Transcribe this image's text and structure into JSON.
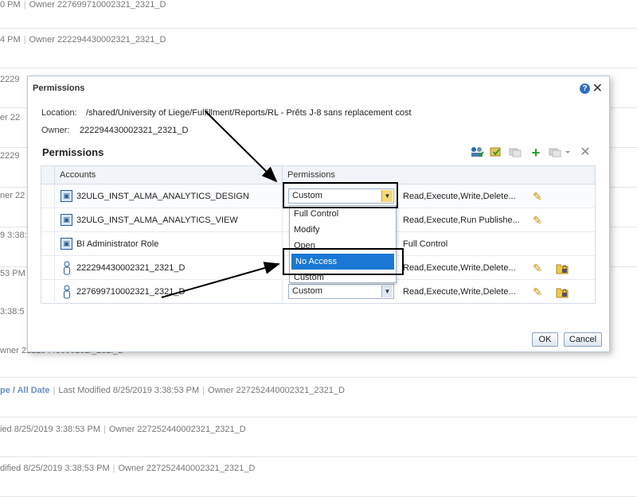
{
  "background": {
    "rows": [
      {
        "text": "0 PM",
        "owner": "Owner 227699710002321_2321_D"
      },
      {
        "text": "4 PM",
        "owner": "Owner 222294430002321_2321_D"
      },
      {
        "text": "2229",
        "owner": ""
      },
      {
        "text": "er 22",
        "owner": ""
      },
      {
        "text": "2229",
        "owner": ""
      },
      {
        "text": "ner 22",
        "owner": ""
      },
      {
        "text": "9 3:38:",
        "owner": ""
      },
      {
        "text": "53 PM",
        "owner": ""
      },
      {
        "text": "3:38:5",
        "owner": ""
      },
      {
        "text": "wner 22229443000232l_232l_D",
        "owner": ""
      }
    ],
    "row_type": {
      "link": "pe / All Date",
      "modified": "Last Modified 8/25/2019 3:38:53 PM",
      "owner": "Owner 227252440002321_2321_D"
    },
    "row_b": {
      "modified": "ied 8/25/2019 3:38:53 PM",
      "owner": "Owner 227252440002321_2321_D"
    },
    "row_c": {
      "modified": "dified 8/25/2019 3:38:53 PM",
      "owner": "Owner 227252440002321_2321_D"
    }
  },
  "dialog": {
    "title": "Permissions",
    "help_symbol": "?",
    "close_symbol": "✕",
    "location_label": "Location:",
    "location_value": "/shared/University of Liege/Fulfillment/Reports/RL - Prêts J-8 sans replacement cost",
    "owner_label": "Owner:",
    "owner_value": "222294430002321_2321_D",
    "section_title": "Permissions",
    "columns": {
      "accounts": "Accounts",
      "permissions": "Permissions"
    },
    "rows": [
      {
        "type": "role",
        "account": "32ULG_INST_ALMA_ANALYTICS_DESIGN",
        "permission": "Custom",
        "detail": "Read,Execute,Write,Delete..."
      },
      {
        "type": "role",
        "account": "32ULG_INST_ALMA_ANALYTICS_VIEW",
        "permission": "",
        "detail": "Read,Execute,Run Publishe..."
      },
      {
        "type": "role",
        "account": "BI Administrator Role",
        "permission": "",
        "detail": "Full Control"
      },
      {
        "type": "user",
        "account": "222294430002321_2321_D",
        "permission": "",
        "detail": "Read,Execute,Write,Delete..."
      },
      {
        "type": "user",
        "account": "227699710002321_2321_D",
        "permission": "Custom",
        "detail": "Read,Execute,Write,Delete..."
      }
    ],
    "dropdown_options": [
      "Full Control",
      "Modify",
      "Open",
      "No Access",
      "Custom"
    ],
    "selected_option": "No Access",
    "ok_label": "OK",
    "cancel_label": "Cancel"
  },
  "colors": {
    "accent": "#1a78d4",
    "dialog_border": "#b9c7d7",
    "header_bg": "#f1f4f8",
    "link": "#6a8fc7"
  }
}
